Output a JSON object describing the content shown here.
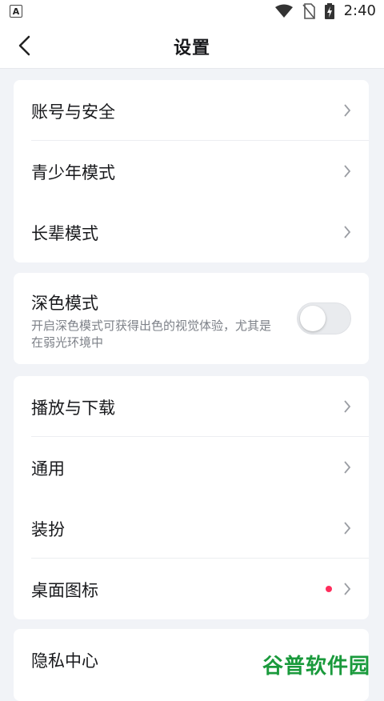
{
  "status_bar": {
    "time": "2:40",
    "app_icon_letter": "A"
  },
  "header": {
    "title": "设置"
  },
  "groups": {
    "account": {
      "items": [
        {
          "label": "账号与安全"
        },
        {
          "label": "青少年模式"
        },
        {
          "label": "长辈模式"
        }
      ]
    },
    "dark_mode": {
      "label": "深色模式",
      "description": "开启深色模式可获得出色的视觉体验，尤其是在弱光环境中",
      "enabled": false
    },
    "general": {
      "items": [
        {
          "label": "播放与下载"
        },
        {
          "label": "通用"
        },
        {
          "label": "装扮"
        },
        {
          "label": "桌面图标",
          "has_badge": true
        }
      ]
    },
    "privacy": {
      "items": [
        {
          "label": "隐私中心"
        }
      ]
    }
  },
  "watermark": "谷普软件园",
  "colors": {
    "badge": "#ff2d5c",
    "background": "#f1f3f7",
    "watermark": "#1a9a3c"
  }
}
